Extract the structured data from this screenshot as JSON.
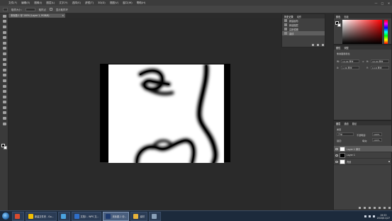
{
  "menubar": {
    "items": [
      "文件(F)",
      "编辑(E)",
      "图像(I)",
      "图层(L)",
      "文字(Y)",
      "选择(S)",
      "滤镜(T)",
      "3D(D)",
      "视图(V)",
      "窗口(W)",
      "帮助(H)"
    ]
  },
  "window_controls": {
    "minimize": "—",
    "maximize": "□",
    "close": "✕"
  },
  "options_bar": {
    "sample_label": "取样大小:",
    "sample_value": "取样点",
    "checkbox_label": "显示取样环"
  },
  "document_tab": {
    "title": "未标题-1 @ 100% (Layer 1, RGB/8)",
    "close": "×"
  },
  "history_panel": {
    "tabs": [
      "历史记录",
      "动作"
    ],
    "items": [
      {
        "label": "新建画布",
        "selected": false
      },
      {
        "label": "新建图层",
        "selected": false
      },
      {
        "label": "高斯模糊",
        "selected": false
      },
      {
        "label": "曲线",
        "selected": true
      }
    ]
  },
  "color_panel": {
    "tabs": [
      "颜色",
      "色板"
    ],
    "foreground": "#000000",
    "background": "#ffffff"
  },
  "properties_panel": {
    "tabs": [
      "属性",
      "调整"
    ],
    "section": "像素图层属性",
    "w_label": "W:",
    "w_value": "14.44 厘米",
    "h_label": "H:",
    "h_value": "10.40 厘米",
    "x_label": "X:",
    "x_value": "1.30 厘米",
    "y_label": "Y:",
    "y_value": "0.18 厘米"
  },
  "layers_panel": {
    "tabs": [
      "图层",
      "通道",
      "路径"
    ],
    "kind_label": "类型",
    "blend_mode": "正常",
    "opacity_label": "不透明度:",
    "opacity_value": "100%",
    "lock_label": "锁定:",
    "fill_label": "填充:",
    "fill_value": "100%",
    "layers": [
      {
        "name": "Layer 1 拷贝",
        "thumb": "#ffffff",
        "selected": true
      },
      {
        "name": "Layer 1",
        "thumb": "#000000",
        "selected": false
      },
      {
        "name": "背景",
        "thumb": "#ffffff",
        "selected": false
      }
    ]
  },
  "taskbar": {
    "tasks": [
      {
        "label": "",
        "icon": "#d94b2e",
        "active": false
      },
      {
        "label": "新建文件夹 - Go...",
        "icon": "#f5c000",
        "active": false
      },
      {
        "label": "",
        "icon": "#4aa3df",
        "active": false
      },
      {
        "label": "文档1 - WPS 文...",
        "icon": "#2f6fc9",
        "active": false
      },
      {
        "label": "未标题-1 @...",
        "icon": "#1e3a6e",
        "active": true
      },
      {
        "label": "素材",
        "icon": "#e9b43a",
        "active": false
      },
      {
        "label": "",
        "icon": "#8aa0b8",
        "active": false
      }
    ],
    "clock_time": "19:53",
    "clock_date": "2018/11/27"
  }
}
